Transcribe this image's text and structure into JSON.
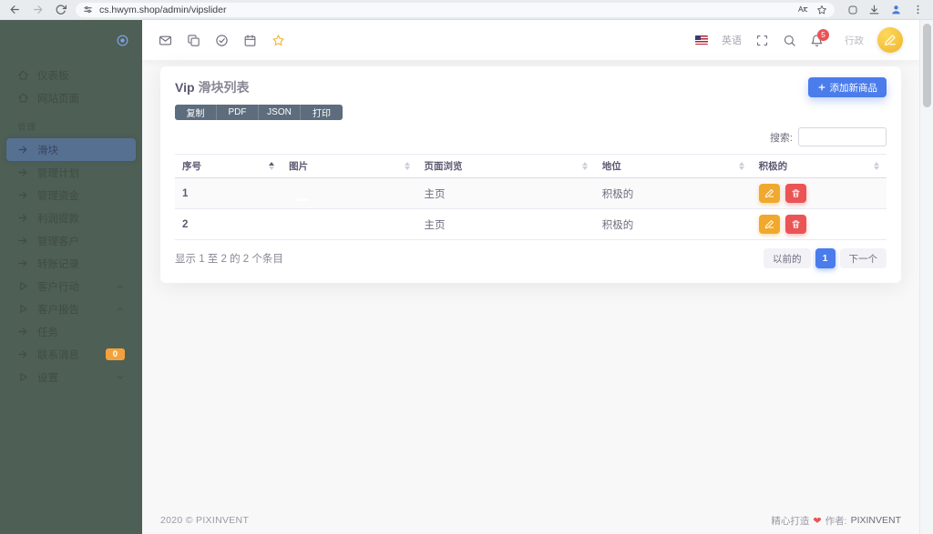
{
  "browser": {
    "url": "cs.hwym.shop/admin/vipslider"
  },
  "sidebar": {
    "section": "管理",
    "items": [
      {
        "label": "仪表板"
      },
      {
        "label": "网站页面"
      },
      {
        "label": "滑块"
      },
      {
        "label": "管理计划"
      },
      {
        "label": "管理资金"
      },
      {
        "label": "利润提款"
      },
      {
        "label": "管理客户"
      },
      {
        "label": "转账记录"
      },
      {
        "label": "客户行动"
      },
      {
        "label": "客户报告"
      },
      {
        "label": "任务"
      },
      {
        "label": "联系消息",
        "badge": "0"
      },
      {
        "label": "设置"
      }
    ]
  },
  "navbar": {
    "language": "英语",
    "notification_count": "5",
    "user_name": "行政"
  },
  "page": {
    "title_prefix": "Vip",
    "title": "滑块列表",
    "export_buttons": [
      "复制",
      "PDF",
      "JSON",
      "打印"
    ],
    "add_button_label": "添加新商品",
    "search_label": "搜索:",
    "table": {
      "headers": [
        "序号",
        "图片",
        "页面浏览",
        "地位",
        "积极的"
      ],
      "rows": [
        {
          "serial": "1",
          "page_view": "主页",
          "status": "积极的"
        },
        {
          "serial": "2",
          "page_view": "主页",
          "status": "积极的"
        }
      ]
    },
    "info_text": "显示 1 至 2 的 2 个条目",
    "pagination": {
      "prev": "以前的",
      "current": "1",
      "next": "下一个"
    }
  },
  "footer": {
    "copyright": "2020 © PIXINVENT",
    "made_with": "精心打造",
    "author_label": "作者:",
    "author": "PIXINVENT"
  },
  "colors": {
    "primary_blue": "#4a7cec",
    "sidebar_green": "#4e5f55",
    "warning_orange": "#f2a23c",
    "danger_red": "#ea5455",
    "export_slate": "#5d6d7d"
  }
}
